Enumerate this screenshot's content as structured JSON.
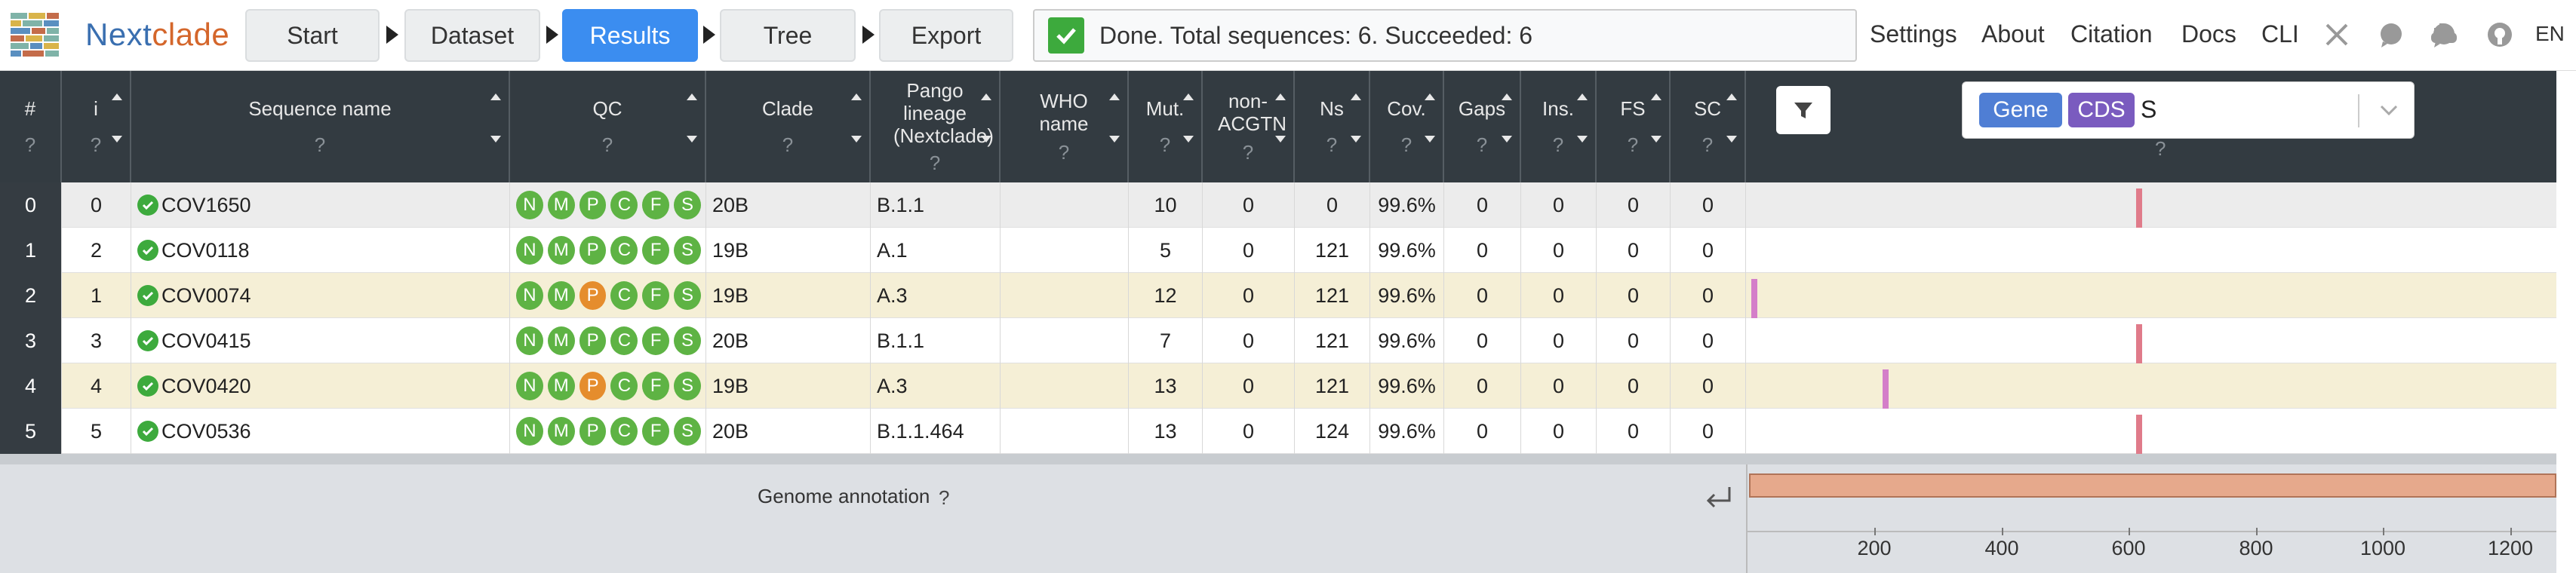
{
  "app": {
    "brand_a": "Next",
    "brand_b": "clade",
    "steps": [
      {
        "label": "Start"
      },
      {
        "label": "Dataset"
      },
      {
        "label": "Results"
      },
      {
        "label": "Tree"
      },
      {
        "label": "Export"
      }
    ],
    "status_text": "Done. Total sequences: 6. Succeeded: 6",
    "nav_links": [
      "Settings",
      "About",
      "Citation",
      "Docs",
      "CLI"
    ],
    "nav_icons": [
      "x-twitter-icon",
      "discussion-icon",
      "docker-icon",
      "github-icon"
    ],
    "language": "EN"
  },
  "columns": [
    {
      "key": "row_index",
      "label": "#",
      "q": "?"
    },
    {
      "key": "i",
      "label": "i",
      "q": "?"
    },
    {
      "key": "name",
      "label": "Sequence name",
      "q": "?"
    },
    {
      "key": "qc",
      "label": "QC",
      "q": "?"
    },
    {
      "key": "clade",
      "label": "Clade",
      "q": "?"
    },
    {
      "key": "pango",
      "label": "Pango lineage (Nextclade)",
      "q": "?"
    },
    {
      "key": "who",
      "label": "WHO name",
      "q": "?"
    },
    {
      "key": "mut",
      "label": "Mut.",
      "q": "?"
    },
    {
      "key": "nonacgtn",
      "label": "non-ACGTN",
      "q": "?"
    },
    {
      "key": "ns",
      "label": "Ns",
      "q": "?"
    },
    {
      "key": "cov",
      "label": "Cov.",
      "q": "?"
    },
    {
      "key": "gaps",
      "label": "Gaps",
      "q": "?"
    },
    {
      "key": "ins",
      "label": "Ins.",
      "q": "?"
    },
    {
      "key": "fs",
      "label": "FS",
      "q": "?"
    },
    {
      "key": "sc",
      "label": "SC",
      "q": "?"
    }
  ],
  "gene_select": {
    "badge_gene": "Gene",
    "badge_cds": "CDS",
    "value": "S",
    "q": "?"
  },
  "qc_letters": [
    "N",
    "M",
    "P",
    "C",
    "F",
    "S"
  ],
  "colors": {
    "qc_good": "#5eb344",
    "qc_mediocre": "#e58d2d",
    "row_highlight": "#f5efd6",
    "row_plain": "#ffffff",
    "row_first": "#ececec",
    "mut_mark": "#e07b8a",
    "ins_mark": "#d47ec9"
  },
  "rows": [
    {
      "row_index": "0",
      "i": "0",
      "name": "COV1650",
      "qc": [
        "good",
        "good",
        "good",
        "good",
        "good",
        "good"
      ],
      "clade": "20B",
      "pango": "B.1.1",
      "who": "",
      "mut": "10",
      "nonacgtn": "0",
      "ns": "0",
      "cov": "99.6%",
      "gaps": "0",
      "ins": "0",
      "fs": "0",
      "sc": "0",
      "marks": [
        {
          "pos": 23400,
          "kind": "mut"
        }
      ]
    },
    {
      "row_index": "1",
      "i": "2",
      "name": "COV0118",
      "qc": [
        "good",
        "good",
        "good",
        "good",
        "good",
        "good"
      ],
      "clade": "19B",
      "pango": "A.1",
      "who": "",
      "mut": "5",
      "nonacgtn": "0",
      "ns": "121",
      "cov": "99.6%",
      "gaps": "0",
      "ins": "0",
      "fs": "0",
      "sc": "0",
      "marks": []
    },
    {
      "row_index": "2",
      "i": "1",
      "name": "COV0074",
      "qc": [
        "good",
        "good",
        "mediocre",
        "good",
        "good",
        "good"
      ],
      "clade": "19B",
      "pango": "A.3",
      "who": "",
      "mut": "12",
      "nonacgtn": "0",
      "ns": "121",
      "cov": "99.6%",
      "gaps": "0",
      "ins": "0",
      "fs": "0",
      "sc": "0",
      "marks": [
        {
          "pos": 21580,
          "kind": "ins"
        }
      ]
    },
    {
      "row_index": "3",
      "i": "3",
      "name": "COV0415",
      "qc": [
        "good",
        "good",
        "good",
        "good",
        "good",
        "good"
      ],
      "clade": "20B",
      "pango": "B.1.1",
      "who": "",
      "mut": "7",
      "nonacgtn": "0",
      "ns": "121",
      "cov": "99.6%",
      "gaps": "0",
      "ins": "0",
      "fs": "0",
      "sc": "0",
      "marks": [
        {
          "pos": 23400,
          "kind": "mut"
        }
      ]
    },
    {
      "row_index": "4",
      "i": "4",
      "name": "COV0420",
      "qc": [
        "good",
        "good",
        "mediocre",
        "good",
        "good",
        "good"
      ],
      "clade": "19B",
      "pango": "A.3",
      "who": "",
      "mut": "13",
      "nonacgtn": "0",
      "ns": "121",
      "cov": "99.6%",
      "gaps": "0",
      "ins": "0",
      "fs": "0",
      "sc": "0",
      "marks": [
        {
          "pos": 22200,
          "kind": "ins"
        }
      ]
    },
    {
      "row_index": "5",
      "i": "5",
      "name": "COV0536",
      "qc": [
        "good",
        "good",
        "good",
        "good",
        "good",
        "good"
      ],
      "clade": "20B",
      "pango": "B.1.1.464",
      "who": "",
      "mut": "13",
      "nonacgtn": "0",
      "ns": "124",
      "cov": "99.6%",
      "gaps": "0",
      "ins": "0",
      "fs": "0",
      "sc": "0",
      "marks": [
        {
          "pos": 23400,
          "kind": "mut"
        }
      ]
    }
  ],
  "annotation": {
    "label": "Genome annotation",
    "q": "?",
    "axis_ticks": [
      "200",
      "400",
      "600",
      "800",
      "1000",
      "1200"
    ]
  }
}
